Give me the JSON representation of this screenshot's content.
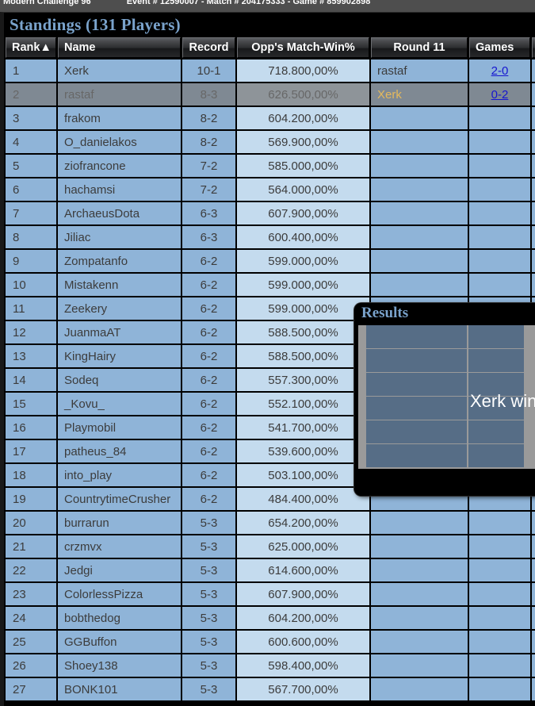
{
  "titlebar": {
    "app_title": "Modern Challenge 96",
    "event_info": "Event # 12590007 - Match # 204175333 - Game # 859902898"
  },
  "standings": {
    "heading": "Standings (131 Players)",
    "columns": [
      {
        "key": "rank",
        "label": "Rank▲"
      },
      {
        "key": "name",
        "label": "Name"
      },
      {
        "key": "record",
        "label": "Record"
      },
      {
        "key": "oppwin",
        "label": "Opp's Match-Win%"
      },
      {
        "key": "round11",
        "label": "Round 11"
      },
      {
        "key": "games",
        "label": "Games"
      }
    ],
    "sort_column": "Rank",
    "sort_direction": "ascending",
    "rows": [
      {
        "rank": "1",
        "name": "Xerk",
        "record": "10-1",
        "oppwin": "718.800,00%",
        "round11": "rastaf",
        "round11_highlight": false,
        "games": "2-0",
        "selected": false
      },
      {
        "rank": "2",
        "name": "rastaf",
        "record": "8-3",
        "oppwin": "626.500,00%",
        "round11": "Xerk",
        "round11_highlight": true,
        "games": "0-2",
        "selected": true
      },
      {
        "rank": "3",
        "name": "frakom",
        "record": "8-2",
        "oppwin": "604.200,00%",
        "round11": "",
        "round11_highlight": false,
        "games": "",
        "selected": false
      },
      {
        "rank": "4",
        "name": "O_danielakos",
        "record": "8-2",
        "oppwin": "569.900,00%",
        "round11": "",
        "round11_highlight": false,
        "games": "",
        "selected": false
      },
      {
        "rank": "5",
        "name": "ziofrancone",
        "record": "7-2",
        "oppwin": "585.000,00%",
        "round11": "",
        "round11_highlight": false,
        "games": "",
        "selected": false
      },
      {
        "rank": "6",
        "name": "hachamsi",
        "record": "7-2",
        "oppwin": "564.000,00%",
        "round11": "",
        "round11_highlight": false,
        "games": "",
        "selected": false
      },
      {
        "rank": "7",
        "name": "ArchaeusDota",
        "record": "6-3",
        "oppwin": "607.900,00%",
        "round11": "",
        "round11_highlight": false,
        "games": "",
        "selected": false
      },
      {
        "rank": "8",
        "name": "Jiliac",
        "record": "6-3",
        "oppwin": "600.400,00%",
        "round11": "",
        "round11_highlight": false,
        "games": "",
        "selected": false
      },
      {
        "rank": "9",
        "name": "Zompatanfo",
        "record": "6-2",
        "oppwin": "599.000,00%",
        "round11": "",
        "round11_highlight": false,
        "games": "",
        "selected": false
      },
      {
        "rank": "10",
        "name": "Mistakenn",
        "record": "6-2",
        "oppwin": "599.000,00%",
        "round11": "",
        "round11_highlight": false,
        "games": "",
        "selected": false
      },
      {
        "rank": "11",
        "name": "Zeekery",
        "record": "6-2",
        "oppwin": "599.000,00%",
        "round11": "",
        "round11_highlight": false,
        "games": "",
        "selected": false
      },
      {
        "rank": "12",
        "name": "JuanmaAT",
        "record": "6-2",
        "oppwin": "588.500,00%",
        "round11": "",
        "round11_highlight": false,
        "games": "",
        "selected": false
      },
      {
        "rank": "13",
        "name": "KingHairy",
        "record": "6-2",
        "oppwin": "588.500,00%",
        "round11": "",
        "round11_highlight": false,
        "games": "",
        "selected": false
      },
      {
        "rank": "14",
        "name": "Sodeq",
        "record": "6-2",
        "oppwin": "557.300,00%",
        "round11": "",
        "round11_highlight": false,
        "games": "",
        "selected": false
      },
      {
        "rank": "15",
        "name": "_Kovu_",
        "record": "6-2",
        "oppwin": "552.100,00%",
        "round11": "",
        "round11_highlight": false,
        "games": "",
        "selected": false
      },
      {
        "rank": "16",
        "name": "Playmobil",
        "record": "6-2",
        "oppwin": "541.700,00%",
        "round11": "",
        "round11_highlight": false,
        "games": "",
        "selected": false
      },
      {
        "rank": "17",
        "name": "patheus_84",
        "record": "6-2",
        "oppwin": "539.600,00%",
        "round11": "",
        "round11_highlight": false,
        "games": "",
        "selected": false
      },
      {
        "rank": "18",
        "name": "into_play",
        "record": "6-2",
        "oppwin": "503.100,00%",
        "round11": "",
        "round11_highlight": false,
        "games": "",
        "selected": false
      },
      {
        "rank": "19",
        "name": "CountrytimeCrusher",
        "record": "6-2",
        "oppwin": "484.400,00%",
        "round11": "",
        "round11_highlight": false,
        "games": "",
        "selected": false
      },
      {
        "rank": "20",
        "name": "burrarun",
        "record": "5-3",
        "oppwin": "654.200,00%",
        "round11": "",
        "round11_highlight": false,
        "games": "",
        "selected": false
      },
      {
        "rank": "21",
        "name": "crzmvx",
        "record": "5-3",
        "oppwin": "625.000,00%",
        "round11": "",
        "round11_highlight": false,
        "games": "",
        "selected": false
      },
      {
        "rank": "22",
        "name": "Jedgi",
        "record": "5-3",
        "oppwin": "614.600,00%",
        "round11": "",
        "round11_highlight": false,
        "games": "",
        "selected": false
      },
      {
        "rank": "23",
        "name": "ColorlessPizza",
        "record": "5-3",
        "oppwin": "607.900,00%",
        "round11": "",
        "round11_highlight": false,
        "games": "",
        "selected": false
      },
      {
        "rank": "24",
        "name": "bobthedog",
        "record": "5-3",
        "oppwin": "604.200,00%",
        "round11": "",
        "round11_highlight": false,
        "games": "",
        "selected": false
      },
      {
        "rank": "25",
        "name": "GGBuffon",
        "record": "5-3",
        "oppwin": "600.600,00%",
        "round11": "",
        "round11_highlight": false,
        "games": "",
        "selected": false
      },
      {
        "rank": "26",
        "name": "Shoey138",
        "record": "5-3",
        "oppwin": "598.400,00%",
        "round11": "",
        "round11_highlight": false,
        "games": "",
        "selected": false
      },
      {
        "rank": "27",
        "name": "BONK101",
        "record": "5-3",
        "oppwin": "567.700,00%",
        "round11": "",
        "round11_highlight": false,
        "games": "",
        "selected": false
      }
    ]
  },
  "results_popup": {
    "title": "Results",
    "overlay_text": "Xerk win",
    "row_count": 6
  },
  "colors": {
    "row_bg": "#8fb4d8",
    "oppwin_bg": "#c4dbee",
    "heading_blue": "#7aa3cc",
    "link_blue": "#1616d0",
    "highlight_gold": "#e5b95c",
    "popup_cell": "#566d86",
    "titlebar_bg": "#4e4e4e"
  }
}
